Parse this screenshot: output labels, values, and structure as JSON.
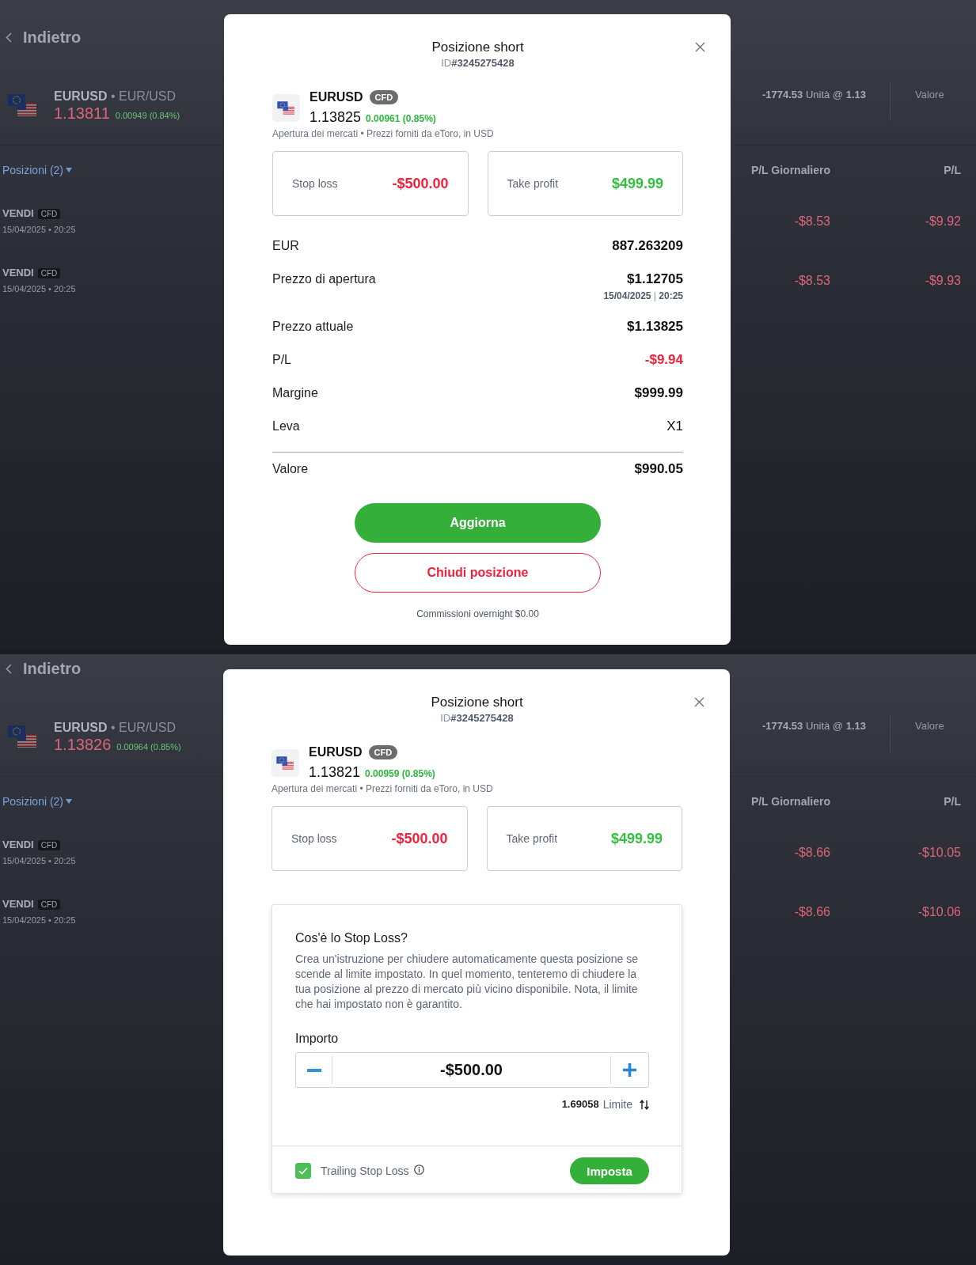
{
  "screens": [
    {
      "page": {
        "back_link": "Indietro",
        "instrument": {
          "title": "**EURUSD** • EUR/USD",
          "price": "1.13811",
          "change": "0.00949 (0.84%)"
        },
        "units": "**-1774.53** Unità @ **1.13**",
        "value_label": "Valore",
        "positions_tab": "Posizioni (2)",
        "columns": [
          "P/L Giornaliero",
          "P/L"
        ],
        "rows": [
          {
            "side": "VENDI",
            "badge": "CFD",
            "opened": "15/04/2025 • 20:25",
            "daily_pl": "-$8.53",
            "pl": "-$9.92"
          },
          {
            "side": "VENDI",
            "badge": "CFD",
            "opened": "15/04/2025 • 20:25",
            "daily_pl": "-$8.53",
            "pl": "-$9.93"
          }
        ]
      },
      "dialog": {
        "title": "Posizione short",
        "position_id": "ID**#3245275428**",
        "instrument": {
          "symbol": "EURUSD",
          "badge": "CFD",
          "price": "1.13825",
          "change": "0.00961 (0.85%)",
          "info": "Apertura dei mercati • Prezzi forniti da eToro, in USD"
        },
        "stop_loss": {
          "label": "Stop loss",
          "value": "-$500.00"
        },
        "take_profit": {
          "label": "Take profit",
          "value": "$499.99"
        },
        "details": [
          {
            "kind": "amount",
            "label": "EUR",
            "value": "887.263209"
          },
          {
            "kind": "amount",
            "label": "Prezzo di apertura",
            "value": "$1.12705",
            "timestamp": "**15/04/2025** | **20:25**"
          },
          {
            "kind": "amount",
            "label": "Prezzo attuale",
            "value": "$1.13825"
          },
          {
            "kind": "loss",
            "label": "P/L",
            "value": "-$9.94"
          },
          {
            "kind": "amount",
            "label": "Margine",
            "value": "$999.99"
          },
          {
            "kind": "plain",
            "label": "Leva",
            "value": "X1"
          }
        ],
        "total": {
          "label": "Valore",
          "value": "$990.05"
        },
        "buttons": [
          {
            "kind": "primary",
            "label": "Aggiorna"
          },
          {
            "kind": "outline",
            "label": "Chiudi posizione"
          }
        ],
        "footnote": "Commissioni overnight $0.00"
      }
    },
    {
      "page": {
        "back_link": "Indietro",
        "instrument": {
          "title": "**EURUSD** • EUR/USD",
          "price": "1.13826",
          "change": "0.00964 (0.85%)"
        },
        "units": "**-1774.53** Unità @ **1.13**",
        "value_label": "Valore",
        "positions_tab": "Posizioni (2)",
        "columns": [
          "P/L Giornaliero",
          "P/L"
        ],
        "rows": [
          {
            "side": "VENDI",
            "badge": "CFD",
            "opened": "15/04/2025 • 20:25",
            "daily_pl": "-$8.66",
            "pl": "-$10.05"
          },
          {
            "side": "VENDI",
            "badge": "CFD",
            "opened": "15/04/2025 • 20:25",
            "daily_pl": "-$8.66",
            "pl": "-$10.06"
          }
        ]
      },
      "dialog": {
        "title": "Posizione short",
        "position_id": "ID**#3245275428**",
        "instrument": {
          "symbol": "EURUSD",
          "badge": "CFD",
          "price": "1.13821",
          "change": "0.00959 (0.85%)",
          "info": "Apertura dei mercati • Prezzi forniti da eToro, in USD"
        },
        "stop_loss": {
          "label": "Stop loss",
          "value": "-$500.00"
        },
        "take_profit": {
          "label": "Take profit",
          "value": "$499.99"
        },
        "stop_loss_help": {
          "title": "Cos'è lo Stop Loss?",
          "text": "Crea un'istruzione per chiudere automaticamente questa posizione se scende al limite impostato. In quel momento, tenteremo di chiudere la tua posizione al prezzo di mercato più vicino disponibile. Nota, il limite che hai impostato non è garantito.",
          "amount_label": "Importo",
          "amount": "-$500.00",
          "rate": "1.69058",
          "rate_label": "Limite",
          "trailing": {
            "label": "Trailing Stop Loss",
            "checked": true
          },
          "button": "Imposta"
        }
      }
    }
  ]
}
